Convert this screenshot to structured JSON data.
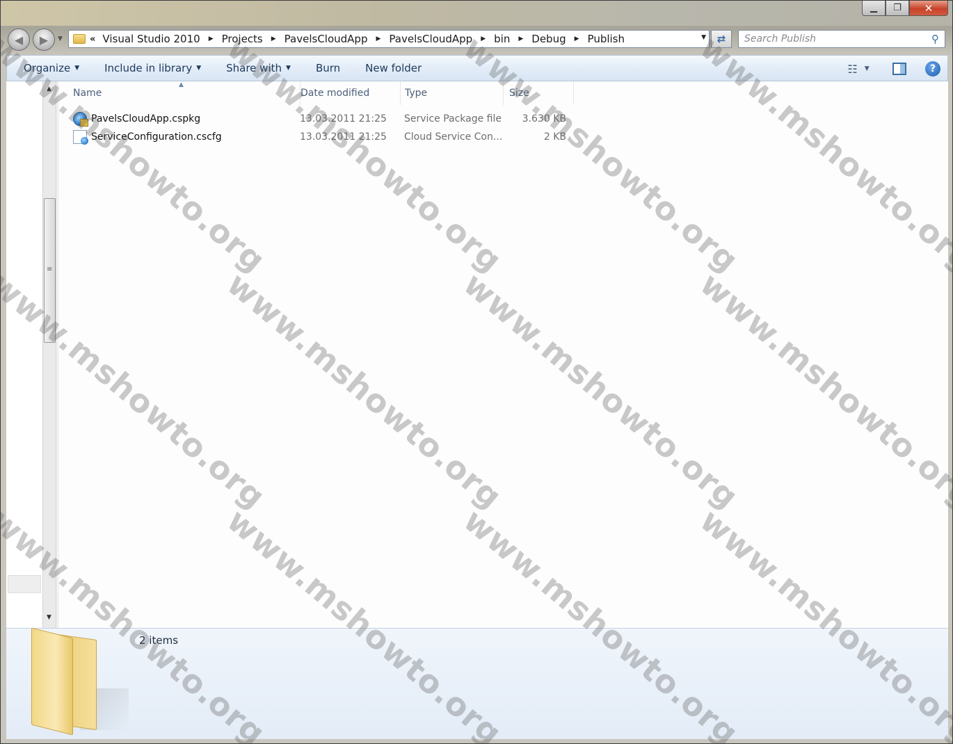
{
  "window": {
    "caption": {
      "minimize": "▁",
      "maximize": "❐",
      "close": "✕"
    }
  },
  "navigation": {
    "back_icon": "back-arrow-icon",
    "forward_icon": "forward-arrow-icon",
    "overflow": "«",
    "breadcrumbs": [
      {
        "label": "Visual Studio 2010"
      },
      {
        "label": "Projects"
      },
      {
        "label": "PavelsCloudApp"
      },
      {
        "label": "PavelsCloudApp"
      },
      {
        "label": "bin"
      },
      {
        "label": "Debug"
      },
      {
        "label": "Publish"
      }
    ],
    "search_placeholder": "Search Publish"
  },
  "toolbar": {
    "organize": "Organize",
    "include_in_library": "Include in library",
    "share_with": "Share with",
    "burn": "Burn",
    "new_folder": "New folder"
  },
  "columns": {
    "name": "Name",
    "date_modified": "Date modified",
    "type": "Type",
    "size": "Size"
  },
  "files": [
    {
      "name": "PavelsCloudApp.cspkg",
      "date": "13.03.2011 21:25",
      "type": "Service Package file",
      "size": "3.630 KB",
      "icon": "service-package-icon"
    },
    {
      "name": "ServiceConfiguration.cscfg",
      "date": "13.03.2011 21:25",
      "type": "Cloud Service Con...",
      "size": "2 KB",
      "icon": "cloud-config-icon"
    }
  ],
  "details": {
    "item_count": "2 items"
  },
  "watermark": "www.mshowto.org",
  "colors": {
    "commandbar": "#e3edf8",
    "text": "#1e395b",
    "close_button": "#c7432b"
  }
}
